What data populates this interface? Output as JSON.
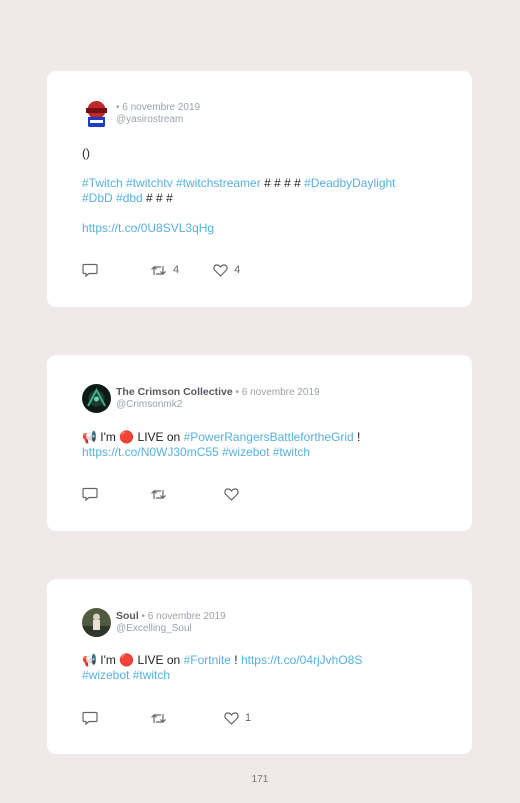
{
  "colors": {
    "background": "#efe9e9",
    "card": "#ffffff",
    "link": "#56b1e0",
    "muted": "#9aa3ab"
  },
  "tweets": [
    {
      "avatar": "yasirostream-avatar",
      "name": "",
      "date": "• 6 novembre 2019",
      "handle": "@yasirostream",
      "line1": "()",
      "tags1": "#Twitch #twitchtv #twitchstreamer",
      "hashes1": " # # # # ",
      "tag2": "#DeadbyDaylight",
      "tags2": "#DbD #dbd",
      "hashes2": " # # #",
      "url": "https://t.co/0U8SVL3qHg",
      "retweets": "4",
      "likes": "4"
    },
    {
      "avatar": "crimsonmk2-avatar",
      "name": "The Crimson Collective",
      "date": " • 6 novembre 2019",
      "handle": "@Crimsonmk2",
      "megaphone": "📢",
      "im": " I'm ",
      "live_dot": "🔴",
      "live_on": " LIVE on ",
      "tag": "#PowerRangersBattlefortheGrid",
      "bang": " !",
      "url": "https://t.co/N0WJ30mC55",
      "tags": "#wizebot #twitch",
      "retweets": "",
      "likes": ""
    },
    {
      "avatar": "excelling-soul-avatar",
      "name": "Soul",
      "date": " • 6 novembre 2019",
      "handle": "@Excelling_Soul",
      "megaphone": "📢",
      "im": " I'm ",
      "live_dot": "🔴",
      "live_on": " LIVE on ",
      "tag": "#Fortnite",
      "bang": " ! ",
      "url": "https://t.co/04rjJvhO8S",
      "tags": "#wizebot #twitch",
      "retweets": "",
      "likes": "1"
    }
  ],
  "page_number": "171"
}
